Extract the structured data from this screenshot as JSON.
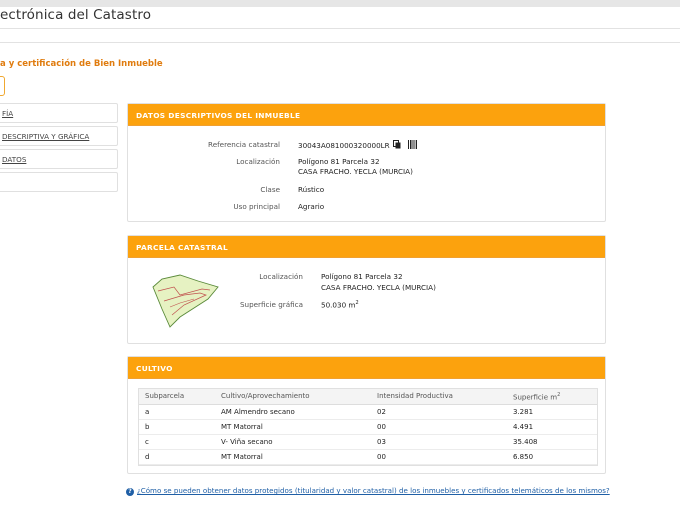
{
  "header": {
    "site_title": "ectrónica del Catastro"
  },
  "page": {
    "subtitle": "a y certificación de Bien Inmueble"
  },
  "menu": {
    "items": [
      "FÍA",
      "DESCRIPTIVA Y GRÁFICA",
      "DATOS",
      ""
    ]
  },
  "descriptive": {
    "title": "DATOS DESCRIPTIVOS DEL INMUEBLE",
    "ref_label": "Referencia catastral",
    "ref_value": "30043A081000320000LR",
    "loc_label": "Localización",
    "loc_line1": "Polígono 81 Parcela 32",
    "loc_line2": "CASA FRACHO. YECLA (MURCIA)",
    "class_label": "Clase",
    "class_value": "Rústico",
    "use_label": "Uso principal",
    "use_value": "Agrario"
  },
  "parcel": {
    "title": "PARCELA CATASTRAL",
    "loc_label": "Localización",
    "loc_line1": "Polígono 81 Parcela 32",
    "loc_line2": "CASA FRACHO. YECLA (MURCIA)",
    "surface_label": "Superficie gráfica",
    "surface_value": "50.030 m",
    "surface_unit_exp": "2"
  },
  "crops": {
    "title": "CULTIVO",
    "headers": [
      "Subparcela",
      "Cultivo/Aprovechamiento",
      "Intensidad Productiva",
      "Superficie m"
    ],
    "header_exp": "2",
    "rows": [
      [
        "a",
        "AM Almendro secano",
        "02",
        "3.281"
      ],
      [
        "b",
        "MT Matorral",
        "00",
        "4.491"
      ],
      [
        "c",
        "V- Viña secano",
        "03",
        "35.408"
      ],
      [
        "d",
        "MT Matorral",
        "00",
        "6.850"
      ]
    ]
  },
  "help": {
    "icon": "question-icon",
    "text": "¿Cómo se pueden obtener datos protegidos (titularidad y valor catastral) de los inmuebles y certificados telemáticos de los mismos?"
  },
  "colors": {
    "accent": "#fca20d",
    "subtitle": "#e07c0f",
    "link": "#1f5fa6"
  }
}
